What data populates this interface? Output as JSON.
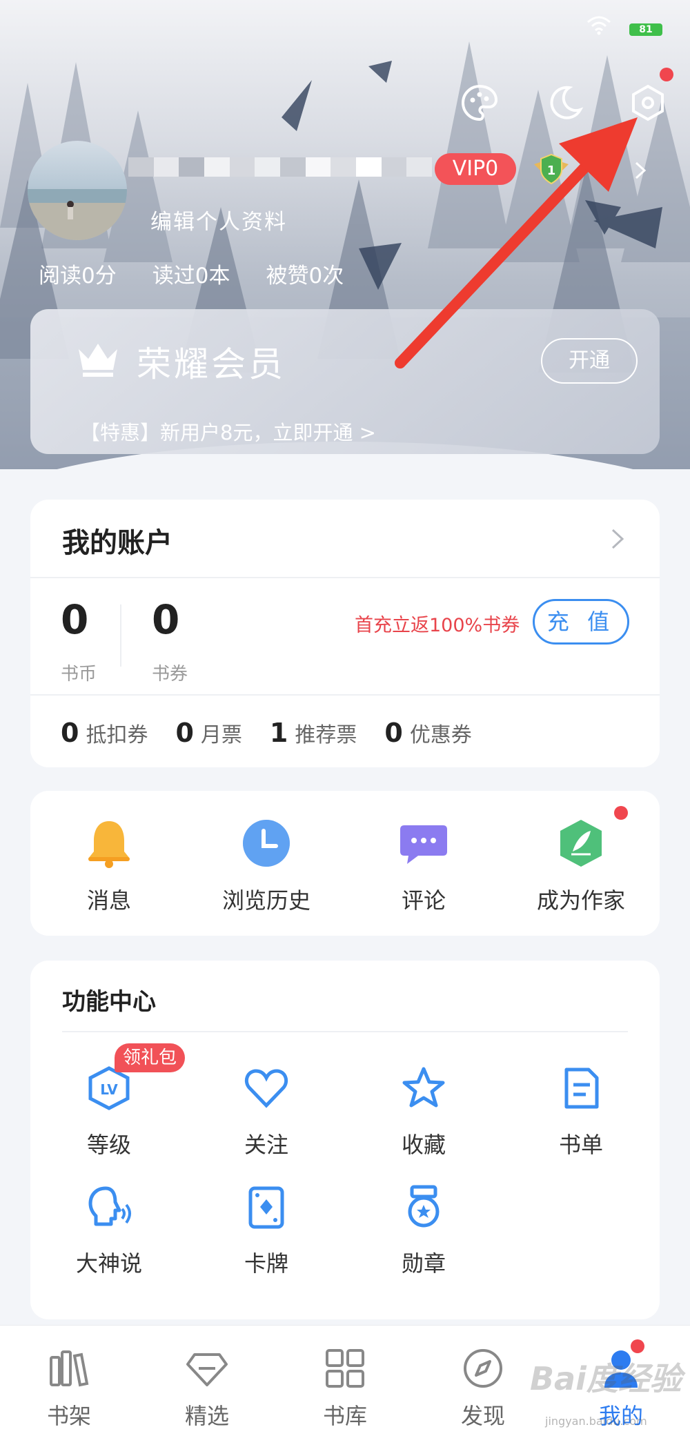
{
  "status": {
    "battery": "81"
  },
  "profile": {
    "vip_label": "VIP0",
    "level_label": "1",
    "edit_label": "编辑个人资料",
    "stats": [
      "阅读0分",
      "读过0本",
      "被赞0次"
    ]
  },
  "membership": {
    "title": "荣耀会员",
    "open_label": "开通",
    "promo": "【特惠】新用户8元，立即开通 >"
  },
  "account": {
    "title": "我的账户",
    "coins": {
      "value": "0",
      "label": "书币"
    },
    "tickets": {
      "value": "0",
      "label": "书券"
    },
    "recharge_promo": "首充立返100%书券",
    "recharge_label": "充 值",
    "vouchers": [
      {
        "count": "0",
        "label": "抵扣券"
      },
      {
        "count": "0",
        "label": "月票"
      },
      {
        "count": "1",
        "label": "推荐票"
      },
      {
        "count": "0",
        "label": "优惠券"
      }
    ]
  },
  "quick_actions": [
    {
      "label": "消息",
      "icon": "bell-icon"
    },
    {
      "label": "浏览历史",
      "icon": "clock-icon"
    },
    {
      "label": "评论",
      "icon": "chat-bubble-icon"
    },
    {
      "label": "成为作家",
      "icon": "quill-icon"
    }
  ],
  "features": {
    "title": "功能中心",
    "gift_badge": "领礼包",
    "items": [
      {
        "label": "等级",
        "icon": "level-icon"
      },
      {
        "label": "关注",
        "icon": "heart-icon"
      },
      {
        "label": "收藏",
        "icon": "star-icon"
      },
      {
        "label": "书单",
        "icon": "booklist-icon"
      },
      {
        "label": "大神说",
        "icon": "speaking-head-icon"
      },
      {
        "label": "卡牌",
        "icon": "card-icon"
      },
      {
        "label": "勋章",
        "icon": "medal-icon"
      }
    ]
  },
  "tabs": [
    {
      "label": "书架",
      "icon": "bookshelf-icon"
    },
    {
      "label": "精选",
      "icon": "diamond-icon"
    },
    {
      "label": "书库",
      "icon": "grid-icon"
    },
    {
      "label": "发现",
      "icon": "compass-icon"
    },
    {
      "label": "我的",
      "icon": "user-icon"
    }
  ],
  "watermark": {
    "main": "Bai度经验",
    "sub": "jingyan.baidu.com"
  },
  "colors": {
    "accent": "#2d7cf0",
    "badge_red": "#f35358",
    "promo_red": "#e8444b",
    "arrow_red": "#ee3b2f"
  }
}
